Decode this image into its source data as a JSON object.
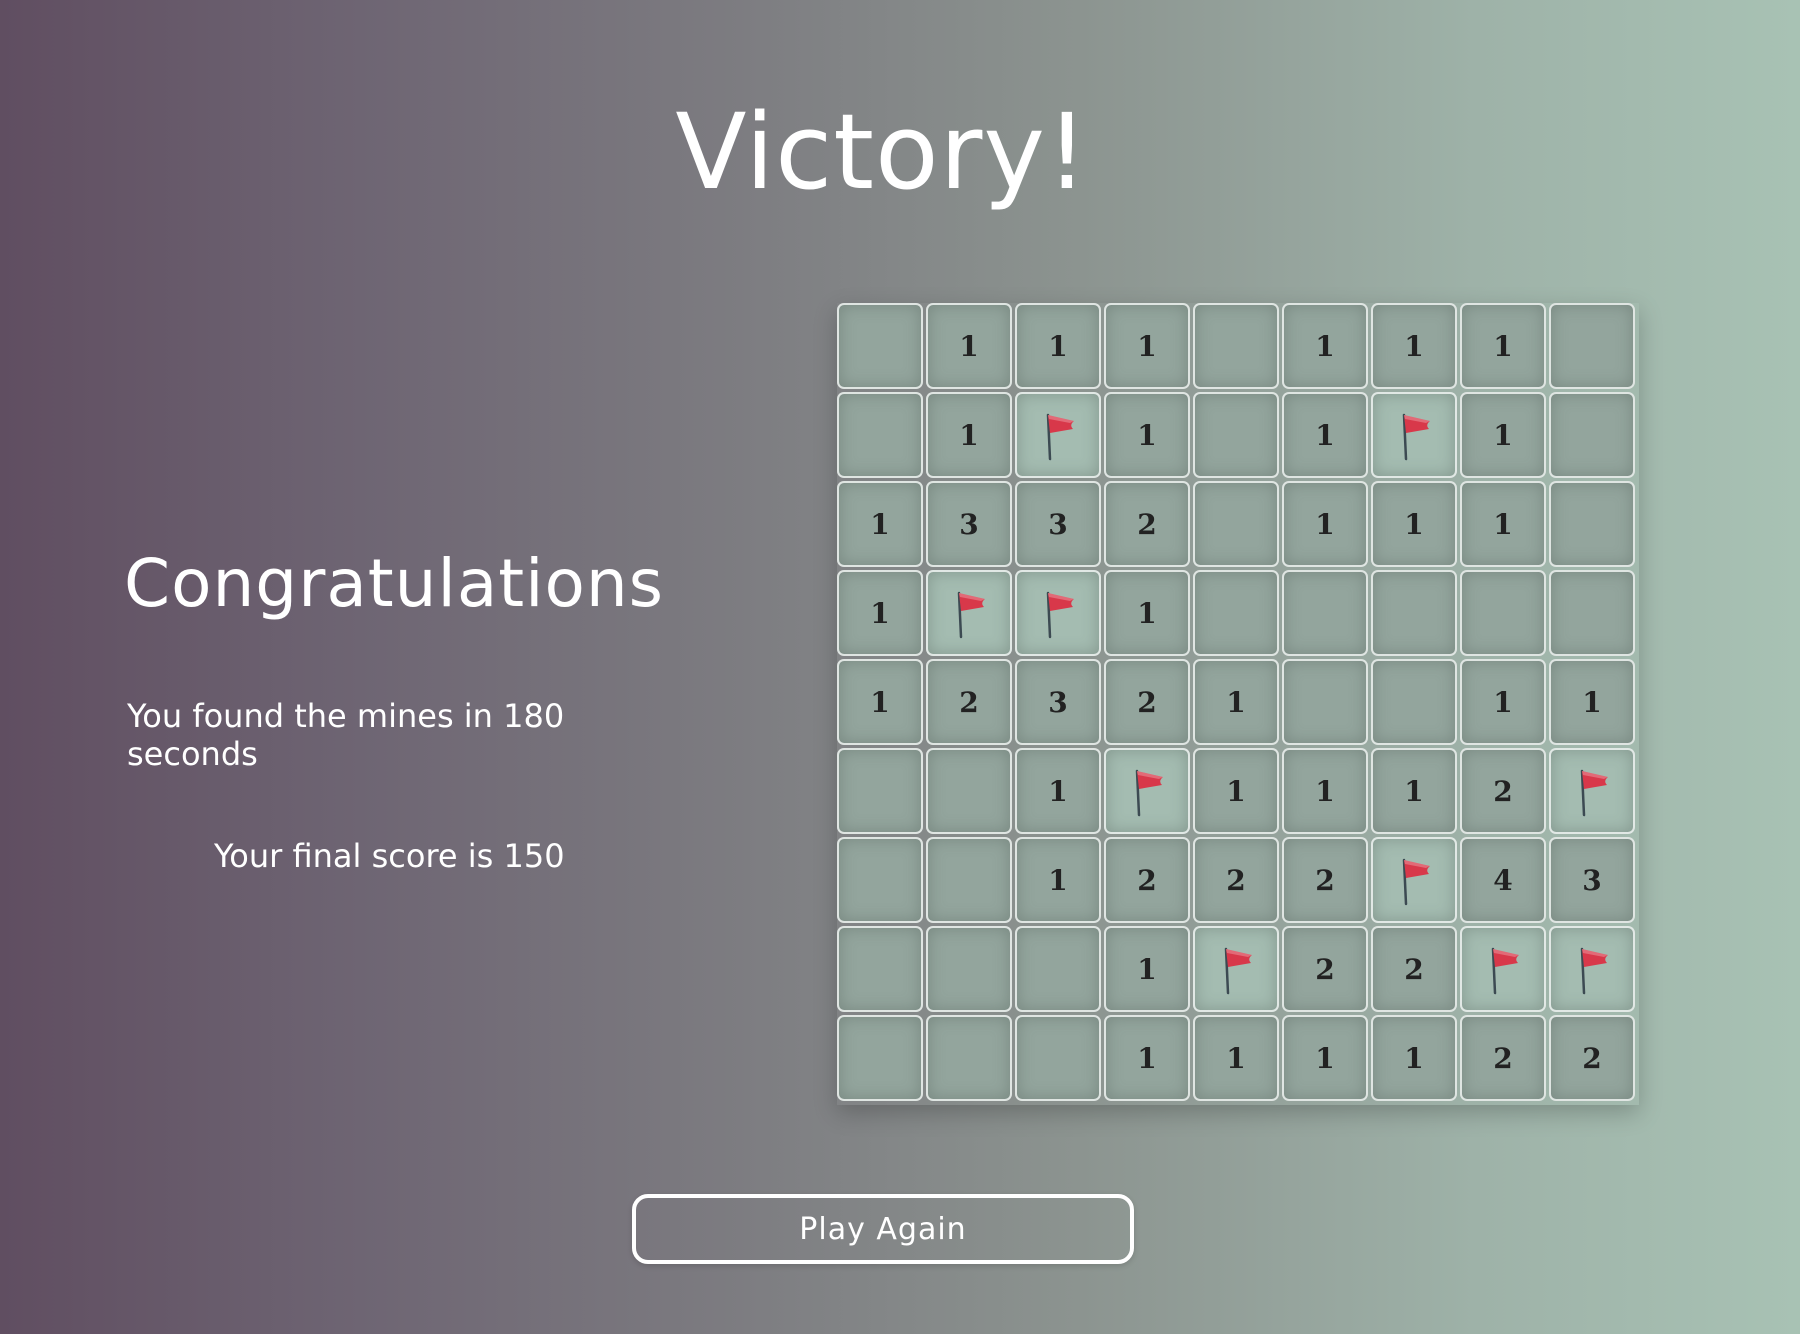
{
  "title": "Victory!",
  "summary": {
    "heading": "Congratulations",
    "time_text": "You found the mines in 180 seconds",
    "score_text": "Your final score is 150"
  },
  "board": {
    "rows": 9,
    "cols": 9,
    "cells": [
      [
        "",
        "1",
        "1",
        "1",
        "",
        "1",
        "1",
        "1",
        ""
      ],
      [
        "",
        "1",
        "F",
        "1",
        "",
        "1",
        "F",
        "1",
        ""
      ],
      [
        "1",
        "3",
        "3",
        "2",
        "",
        "1",
        "1",
        "1",
        ""
      ],
      [
        "1",
        "F",
        "F",
        "1",
        "",
        "",
        "",
        "",
        ""
      ],
      [
        "1",
        "2",
        "3",
        "2",
        "1",
        "",
        "",
        "1",
        "1"
      ],
      [
        "",
        "",
        "1",
        "F",
        "1",
        "1",
        "1",
        "2",
        "F"
      ],
      [
        "",
        "",
        "1",
        "2",
        "2",
        "2",
        "F",
        "4",
        "3"
      ],
      [
        "",
        "",
        "",
        "1",
        "F",
        "2",
        "2",
        "F",
        "F"
      ],
      [
        "",
        "",
        "",
        "1",
        "1",
        "1",
        "1",
        "2",
        "2"
      ]
    ],
    "flag_icon": "flag-icon",
    "flag_color": "#d8384a"
  },
  "actions": {
    "play_again_label": "Play Again"
  }
}
